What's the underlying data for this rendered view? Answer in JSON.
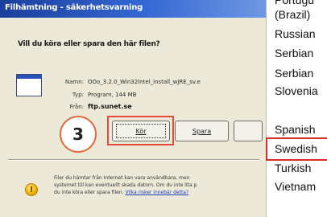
{
  "dialog": {
    "title": "Filhämtning - säkerhetsvarning",
    "question": "Vill du köra eller spara den här filen?",
    "file": {
      "name_label": "Namn:",
      "name_value": "OOo_3.2.0_Win32Intel_install_wJRE_sv.e",
      "type_label": "Typ:",
      "type_value": "Program, 144 MB",
      "from_label": "Från:",
      "from_value": "ftp.sunet.se"
    },
    "buttons": {
      "open": "Kör",
      "save": "Spara"
    },
    "step_number": "3",
    "warning": {
      "line1": "Filer du hämtar från Internet kan vara användbara, men",
      "line2": "systemet till kan eventuellt skada datorn. Om du inte lita p",
      "line3_prefix": "du inte köra eller spara filen. ",
      "line3_link": "Vilka risker innebär detta?"
    }
  },
  "language_list": {
    "items": [
      "Portugu",
      "(Brazil)",
      "Russian",
      "Serbian",
      "Serbian",
      "Slovenia",
      "Spanish",
      "Swedish",
      "Turkish",
      "Vietnam"
    ],
    "highlighted": "Swedish"
  },
  "colors": {
    "title_bar": "#2a52be",
    "highlight_red": "#d32e24",
    "step_badge_border": "#e56b3f"
  }
}
